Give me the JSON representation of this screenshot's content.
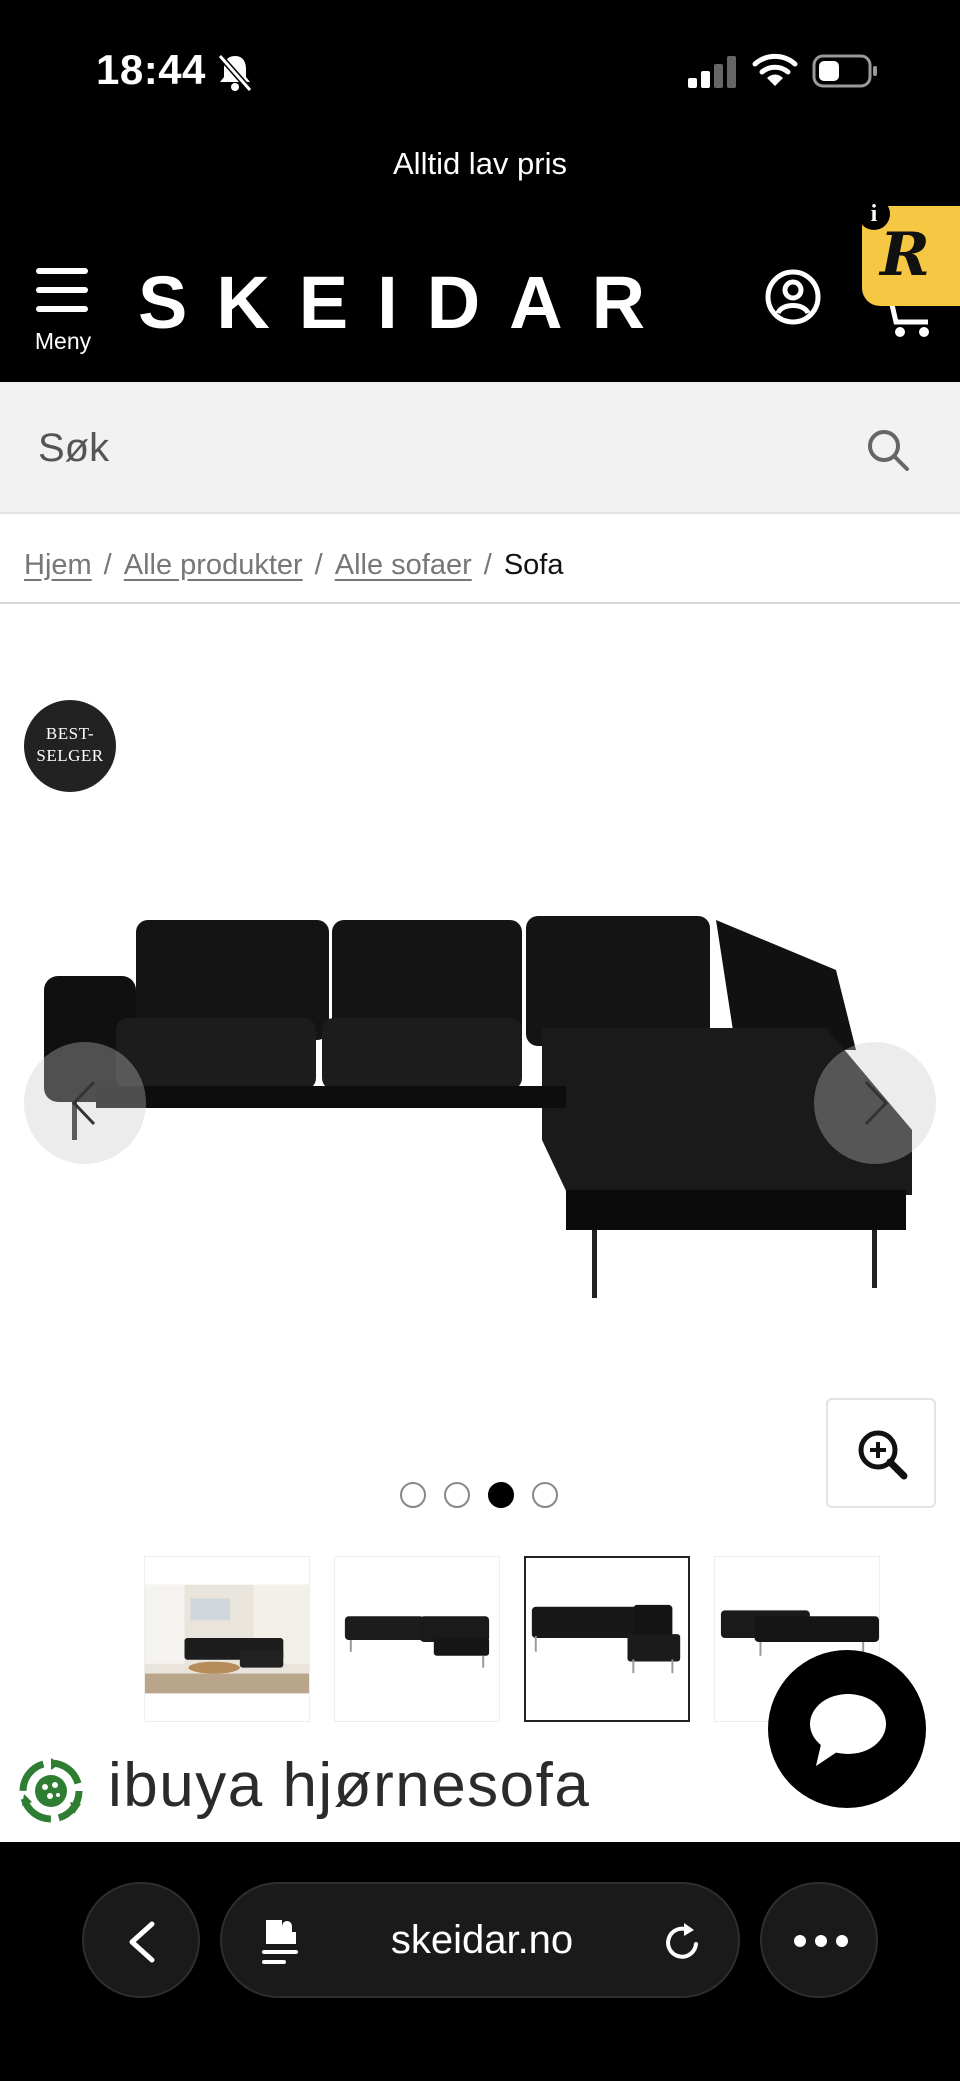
{
  "status_bar": {
    "time": "18:44"
  },
  "promo": {
    "text": "Alltid lav pris"
  },
  "header": {
    "menu_label": "Meny",
    "logo_text": "SKEIDAR",
    "review_badge_letter": "R",
    "review_info": "i"
  },
  "search": {
    "placeholder": "Søk"
  },
  "breadcrumb": {
    "items": [
      "Hjem",
      "Alle produkter",
      "Alle sofaer"
    ],
    "separator": "/",
    "current": "Sofa"
  },
  "gallery": {
    "badge": [
      "BEST-",
      "SELGER"
    ],
    "slide_count": 4,
    "active_slide": 3,
    "selected_thumbnail": 3
  },
  "product": {
    "title": "ibuya hjørnesofa"
  },
  "browser": {
    "url": "skeidar.no"
  },
  "colors": {
    "header_bg": "#000000",
    "search_bg": "#f2f2f2",
    "review_badge": "#f6c743",
    "ibuya_green": "#2e7d32"
  },
  "icons": [
    "bell-off-icon",
    "cell-signal-icon",
    "wifi-icon",
    "battery-icon",
    "hamburger-icon",
    "account-icon",
    "cart-icon",
    "search-icon",
    "chevron-left-icon",
    "chevron-right-icon",
    "zoom-in-icon",
    "chat-bubble-icon",
    "page-menu-icon",
    "reload-icon",
    "more-icon"
  ]
}
